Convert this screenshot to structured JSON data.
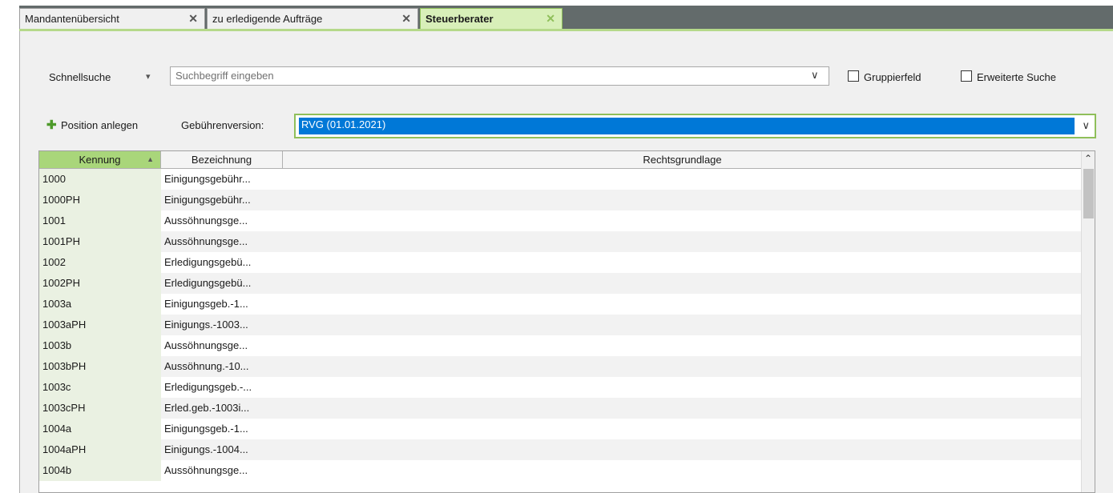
{
  "tabs": [
    {
      "label": "Mandantenübersicht",
      "close": "✕"
    },
    {
      "label": "zu erledigende Aufträge",
      "close": "✕"
    },
    {
      "label": "Steuerberater",
      "close": "✕"
    }
  ],
  "search": {
    "label": "Schnellsuche",
    "dropdown_glyph": "▾",
    "placeholder": "Suchbegriff eingeben",
    "chevron": "∨"
  },
  "options": {
    "gruppierfeld": "Gruppierfeld",
    "erweiterte_suche": "Erweiterte Suche"
  },
  "toolbar": {
    "add_icon": "✚",
    "add_label": "Position anlegen",
    "version_label": "Gebührenversion:",
    "version_value": "RVG (01.01.2021)",
    "chevron": "∨"
  },
  "table": {
    "columns": [
      "Kennung",
      "Bezeichnung",
      "Rechtsgrundlage"
    ],
    "sort_indicator": "▲",
    "scroll_up": "⌃",
    "rows": [
      {
        "kennung": "1000",
        "bezeichnung": "Einigungsgebühr...",
        "rechtsgrundlage": ""
      },
      {
        "kennung": "1000PH",
        "bezeichnung": "Einigungsgebühr...",
        "rechtsgrundlage": ""
      },
      {
        "kennung": "1001",
        "bezeichnung": "Aussöhnungsge...",
        "rechtsgrundlage": ""
      },
      {
        "kennung": "1001PH",
        "bezeichnung": "Aussöhnungsge...",
        "rechtsgrundlage": ""
      },
      {
        "kennung": "1002",
        "bezeichnung": "Erledigungsgebü...",
        "rechtsgrundlage": ""
      },
      {
        "kennung": "1002PH",
        "bezeichnung": "Erledigungsgebü...",
        "rechtsgrundlage": ""
      },
      {
        "kennung": "1003a",
        "bezeichnung": "Einigungsgeb.-1...",
        "rechtsgrundlage": ""
      },
      {
        "kennung": "1003aPH",
        "bezeichnung": "Einigungs.-1003...",
        "rechtsgrundlage": ""
      },
      {
        "kennung": "1003b",
        "bezeichnung": "Aussöhnungsge...",
        "rechtsgrundlage": ""
      },
      {
        "kennung": "1003bPH",
        "bezeichnung": "Aussöhnung.-10...",
        "rechtsgrundlage": ""
      },
      {
        "kennung": "1003c",
        "bezeichnung": "Erledigungsgeb.-...",
        "rechtsgrundlage": ""
      },
      {
        "kennung": "1003cPH",
        "bezeichnung": "Erled.geb.-1003i...",
        "rechtsgrundlage": ""
      },
      {
        "kennung": "1004a",
        "bezeichnung": "Einigungsgeb.-1...",
        "rechtsgrundlage": ""
      },
      {
        "kennung": "1004aPH",
        "bezeichnung": "Einigungs.-1004...",
        "rechtsgrundlage": ""
      },
      {
        "kennung": "1004b",
        "bezeichnung": "Aussöhnungsge...",
        "rechtsgrundlage": ""
      }
    ]
  },
  "colors": {
    "accent_green": "#8fbf5a",
    "selection_blue": "#0078d7",
    "tabbar_dark": "#636b6b"
  }
}
